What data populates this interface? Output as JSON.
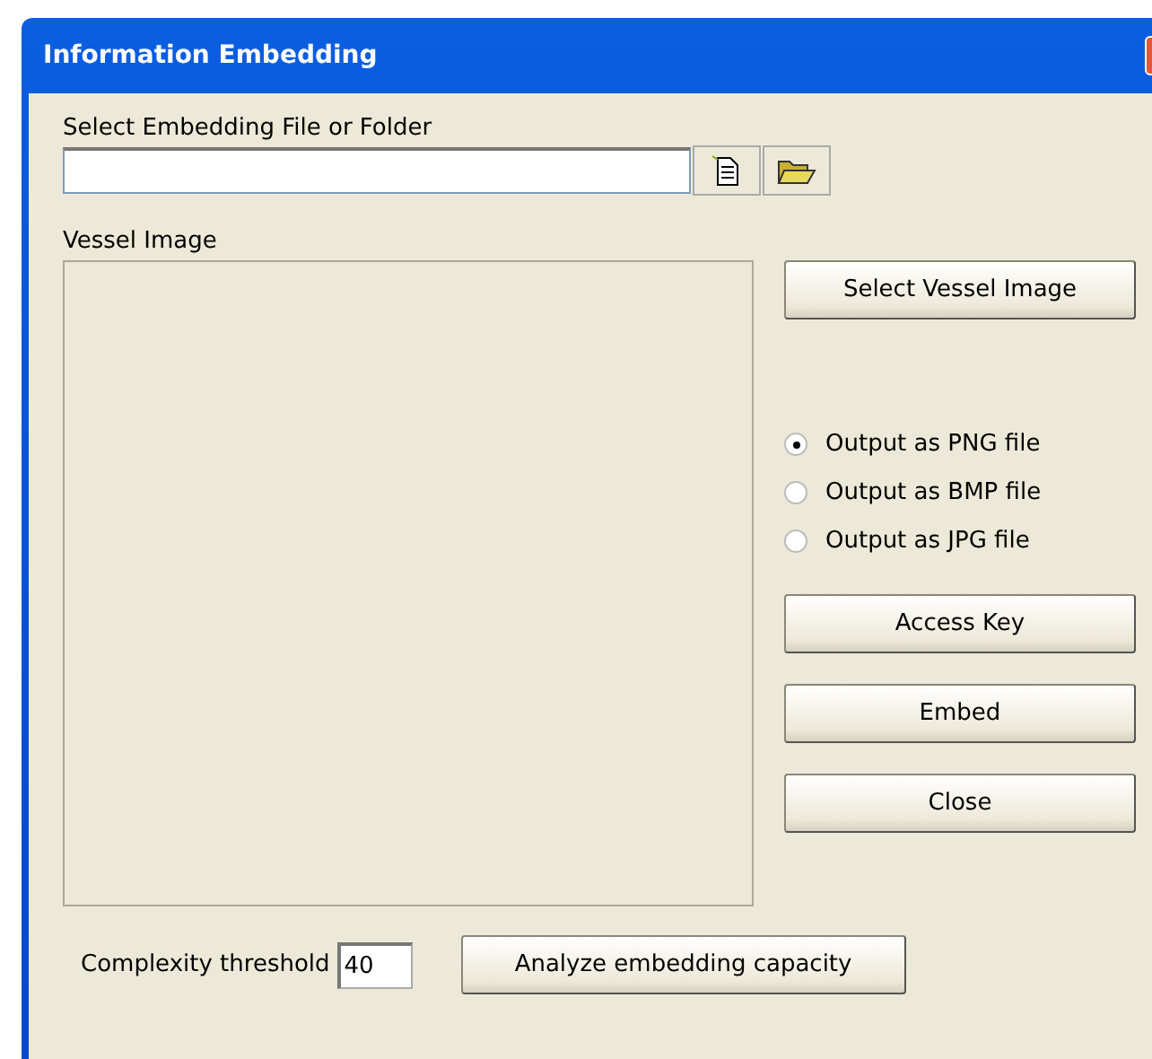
{
  "window": {
    "title": "Information Embedding"
  },
  "file_select": {
    "label": "Select Embedding File or Folder"
  },
  "vessel_image": {
    "label": "Vessel Image",
    "button": "Select Vessel Image"
  },
  "output_formats": [
    {
      "label": "Output as PNG file",
      "selected": true
    },
    {
      "label": "Output as BMP file",
      "selected": false
    },
    {
      "label": "Output as JPG file",
      "selected": false
    }
  ],
  "buttons": [
    "Access Key",
    "Embed",
    "Close"
  ],
  "threshold": {
    "label": "Complexity threshold",
    "value": "40"
  },
  "analyze_button": "Analyze embedding capacity"
}
